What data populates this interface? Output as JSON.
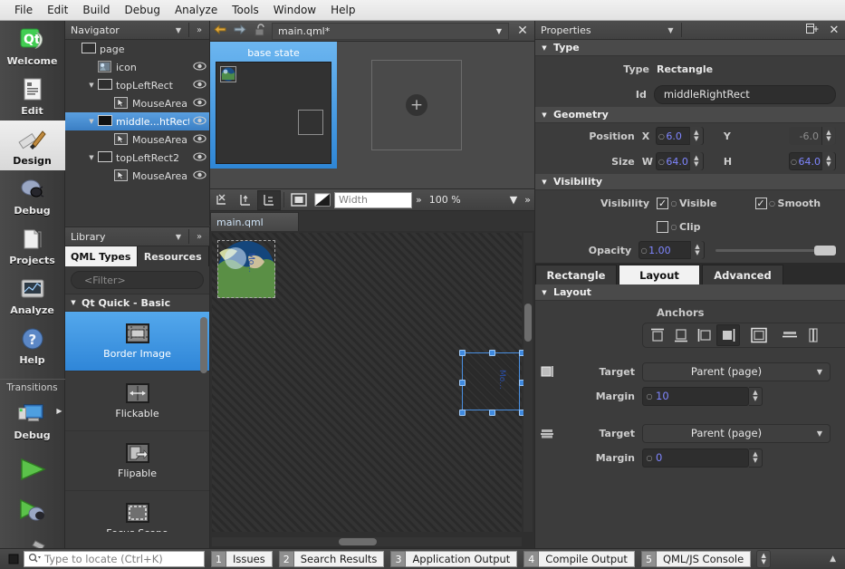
{
  "menu": {
    "items": [
      "File",
      "Edit",
      "Build",
      "Debug",
      "Analyze",
      "Tools",
      "Window",
      "Help"
    ]
  },
  "modebar": {
    "items": [
      {
        "label": "Welcome",
        "icon": "qt-logo-icon",
        "active": false
      },
      {
        "label": "Edit",
        "icon": "document-icon",
        "active": false
      },
      {
        "label": "Design",
        "icon": "brush-ruler-icon",
        "active": true
      },
      {
        "label": "Debug",
        "icon": "bug-icon",
        "active": false
      },
      {
        "label": "Projects",
        "icon": "folder-icon",
        "active": false
      },
      {
        "label": "Analyze",
        "icon": "monitor-graph-icon",
        "active": false
      },
      {
        "label": "Help",
        "icon": "question-mark-icon",
        "active": false
      }
    ],
    "transitions_label": "Transitions",
    "kit_label": "Debug",
    "kit_icon": "computer-icon",
    "run_buttons": [
      "run-icon",
      "debug-run-icon",
      "build-hammer-icon"
    ]
  },
  "navigator": {
    "title": "Navigator",
    "items": [
      {
        "label": "page",
        "indent": 0,
        "icon": "rect-icon",
        "twisty": "",
        "eye": false,
        "selected": false
      },
      {
        "label": "icon",
        "indent": 1,
        "icon": "image-icon",
        "twisty": "",
        "eye": true,
        "selected": false
      },
      {
        "label": "topLeftRect",
        "indent": 1,
        "icon": "rect-icon",
        "twisty": "down",
        "eye": true,
        "selected": false
      },
      {
        "label": "MouseArea",
        "indent": 2,
        "icon": "mouse-icon",
        "twisty": "",
        "eye": true,
        "selected": false
      },
      {
        "label": "middle...htRect",
        "indent": 1,
        "icon": "rect-icon",
        "twisty": "down",
        "eye": true,
        "selected": true
      },
      {
        "label": "MouseArea",
        "indent": 2,
        "icon": "mouse-icon",
        "twisty": "",
        "eye": true,
        "selected": false
      },
      {
        "label": "topLeftRect2",
        "indent": 1,
        "icon": "rect-icon",
        "twisty": "down",
        "eye": true,
        "selected": false
      },
      {
        "label": "MouseArea",
        "indent": 2,
        "icon": "mouse-icon",
        "twisty": "",
        "eye": true,
        "selected": false
      }
    ]
  },
  "library": {
    "title": "Library",
    "tabs": [
      {
        "label": "QML Types",
        "active": true
      },
      {
        "label": "Resources",
        "active": false
      }
    ],
    "filter_placeholder": "<Filter>",
    "section": "Qt Quick - Basic",
    "items": [
      {
        "label": "Border Image",
        "icon": "border-image-icon",
        "selected": true
      },
      {
        "label": "Flickable",
        "icon": "flickable-icon",
        "selected": false
      },
      {
        "label": "Flipable",
        "icon": "flipable-icon",
        "selected": false
      },
      {
        "label": "Focus Scope",
        "icon": "focus-scope-icon",
        "selected": false
      }
    ]
  },
  "editor": {
    "back_icon": "back-arrow-icon",
    "forward_icon": "forward-arrow-icon",
    "lock_icon": "unlocked-icon",
    "filename": "main.qml*",
    "close_icon": "close-icon",
    "states": {
      "base_state_label": "base state",
      "add_state_icon": "plus-icon"
    },
    "toolbar": {
      "buttons": [
        "no-anchors-icon",
        "anchor-fill-icon",
        "anchor-reset-icon",
        "frame-icon",
        "contrast-icon"
      ],
      "width_placeholder": "Width",
      "chevron": "»",
      "zoom": "100 %",
      "zoom_arrow": "chevron-down-icon"
    },
    "file_tab": "main.qml"
  },
  "properties": {
    "title": "Properties",
    "new_icon": "new-window-icon",
    "close_icon": "close-icon",
    "type_section": {
      "header": "Type",
      "type_label": "Type",
      "type_value": "Rectangle",
      "id_label": "Id",
      "id_value": "middleRightRect"
    },
    "geometry_section": {
      "header": "Geometry",
      "position_label": "Position",
      "x_label": "X",
      "x_value": "6.0",
      "y_label": "Y",
      "y_value": "-6.0",
      "y_disabled": true,
      "size_label": "Size",
      "w_label": "W",
      "w_value": "64.0",
      "h_label": "H",
      "h_value": "64.0"
    },
    "visibility_section": {
      "header": "Visibility",
      "row_label": "Visibility",
      "visible_label": "Visible",
      "visible_checked": true,
      "smooth_label": "Smooth",
      "smooth_checked": true,
      "clip_label": "Clip",
      "clip_checked": false,
      "opacity_label": "Opacity",
      "opacity_value": "1.00",
      "opacity_pct": 100
    },
    "tabs": [
      {
        "label": "Rectangle",
        "active": false
      },
      {
        "label": "Layout",
        "active": true
      },
      {
        "label": "Advanced",
        "active": false
      }
    ],
    "layout_section": {
      "header": "Layout",
      "anchors_label": "Anchors",
      "anchor_buttons": [
        {
          "name": "anchor-top-icon",
          "on": false
        },
        {
          "name": "anchor-bottom-icon",
          "on": false
        },
        {
          "name": "anchor-left-icon",
          "on": false
        },
        {
          "name": "anchor-right-icon",
          "on": true
        },
        {
          "name": "anchor-fill-icon",
          "on": false
        },
        {
          "name": "anchor-vcenter-icon",
          "on": false
        },
        {
          "name": "anchor-hcenter-icon",
          "on": false
        }
      ],
      "rows": [
        {
          "icon": "anchor-right-icon",
          "target_label": "Target",
          "target_value": "Parent (page)",
          "margin_label": "Margin",
          "margin_value": "10"
        },
        {
          "icon": "anchor-vcenter-icon",
          "target_label": "Target",
          "target_value": "Parent (page)",
          "margin_label": "Margin",
          "margin_value": "0"
        }
      ]
    }
  },
  "statusbar": {
    "stop_icon": "stop-icon",
    "locate_placeholder": "Type to locate (Ctrl+K)",
    "search_icon": "search-icon",
    "outputs": [
      {
        "num": "1",
        "label": "Issues"
      },
      {
        "num": "2",
        "label": "Search Results"
      },
      {
        "num": "3",
        "label": "Application Output"
      },
      {
        "num": "4",
        "label": "Compile Output"
      },
      {
        "num": "5",
        "label": "QML/JS Console"
      }
    ]
  },
  "colors": {
    "accent_blue": "#3b7fc4",
    "selection_blue": "#4a90e2",
    "value_blue": "#7f86ff",
    "panel_bg": "#3c3c3c"
  }
}
